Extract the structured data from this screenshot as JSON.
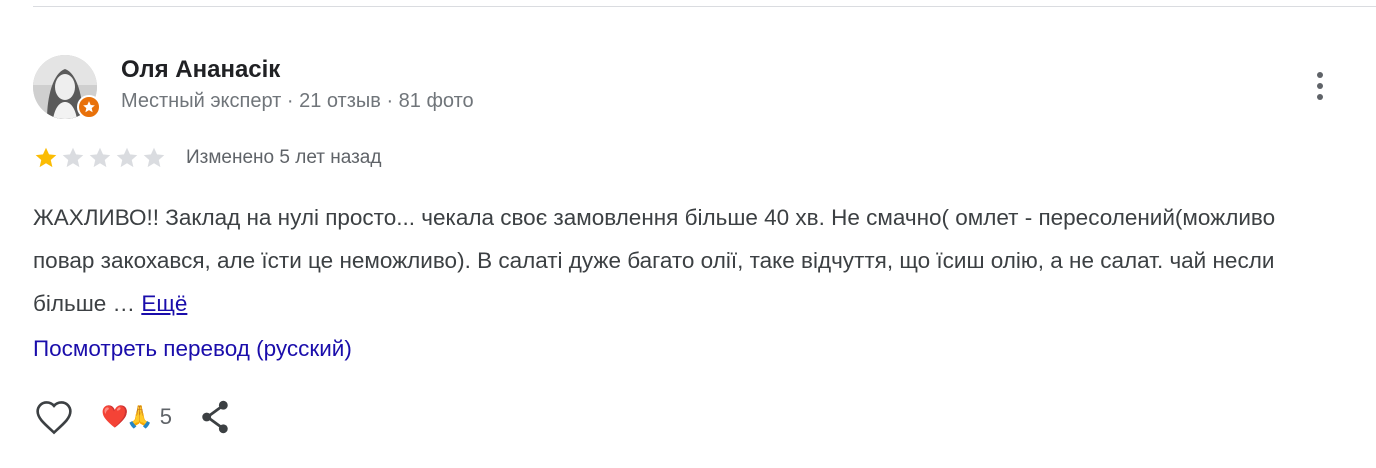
{
  "review": {
    "author": {
      "name": "Оля Ананасік",
      "meta": "Местный эксперт · 21 отзыв · 81 фото",
      "badge_color": "#e8710a"
    },
    "rating": {
      "value": 1,
      "max": 5,
      "filled_color": "#fbbc04",
      "empty_color": "#dadce0"
    },
    "edited_label": "Изменено 5 лет назад",
    "text": "ЖАХЛИВО!! Заклад на нулі просто... чекала своє замовлення більше 40 хв. Не смачно( омлет - пересолений(можливо повар закохався, але їсти це неможливо). В салаті дуже багато олії, таке відчуття, що їсиш олію, а не салат. чай несли більше … ",
    "more_label": "Ещё",
    "translate_label": "Посмотреть перевод (русский)",
    "actions": {
      "like_icon": "heart-outline-icon",
      "reaction_emojis": "❤️🙏",
      "reaction_count": "5",
      "share_icon": "share-icon"
    },
    "menu_icon": "more-vert-icon",
    "link_color": "#1a0dab"
  }
}
